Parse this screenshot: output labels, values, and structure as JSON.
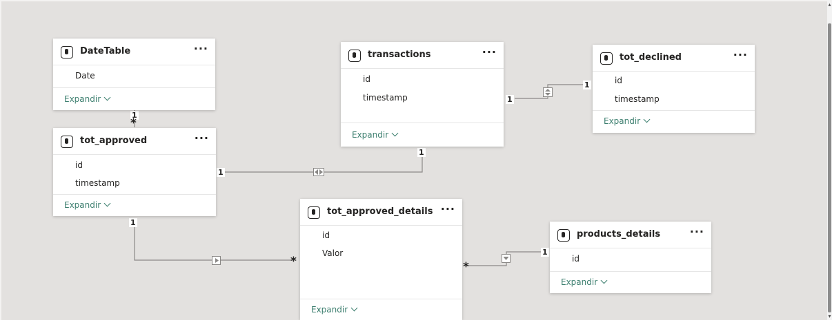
{
  "diagram": {
    "tables": {
      "date_table": {
        "title": "DateTable",
        "fields": [
          "Date"
        ],
        "expand_label": "Expandir"
      },
      "transactions": {
        "title": "transactions",
        "fields": [
          "id",
          "timestamp"
        ],
        "expand_label": "Expandir"
      },
      "tot_declined": {
        "title": "tot_declined",
        "fields": [
          "id",
          "timestamp"
        ],
        "expand_label": "Expandir"
      },
      "tot_approved": {
        "title": "tot_approved",
        "fields": [
          "id",
          "timestamp"
        ],
        "expand_label": "Expandir"
      },
      "tot_approved_details": {
        "title": "tot_approved_details",
        "fields": [
          "id",
          "Valor"
        ],
        "expand_label": "Expandir"
      },
      "products_details": {
        "title": "products_details",
        "fields": [
          "id"
        ],
        "expand_label": "Expandir"
      }
    },
    "more_label": "···",
    "relationships": [
      {
        "from": "DateTable",
        "to": "tot_approved",
        "from_cardinality": "1",
        "to_cardinality": "*",
        "filter_direction": "single"
      },
      {
        "from": "transactions",
        "to": "tot_declined",
        "from_cardinality": "1",
        "to_cardinality": "1",
        "filter_direction": "both"
      },
      {
        "from": "tot_approved",
        "to": "transactions",
        "from_cardinality": "1",
        "to_cardinality": "1",
        "filter_direction": "both"
      },
      {
        "from": "tot_approved",
        "to": "tot_approved_details",
        "from_cardinality": "1",
        "to_cardinality": "*",
        "filter_direction": "single"
      },
      {
        "from": "tot_approved_details",
        "to": "products_details",
        "from_cardinality": "*",
        "to_cardinality": "1",
        "filter_direction": "single"
      }
    ],
    "labels": {
      "one": "1",
      "many": "*"
    },
    "colors": {
      "canvas": "#e3e1df",
      "card": "#ffffff",
      "accent_link": "#3d7f6f",
      "line": "#8a8886",
      "text": "#252423"
    }
  }
}
